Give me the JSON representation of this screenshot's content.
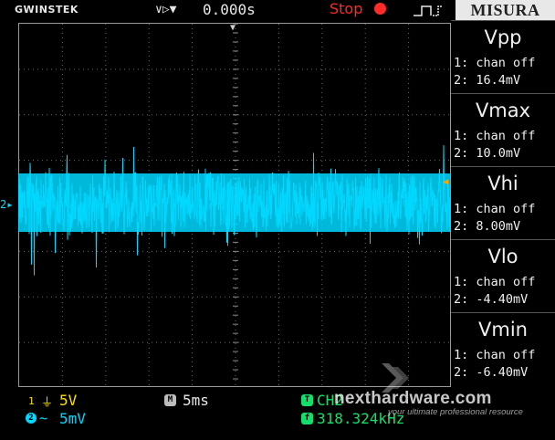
{
  "header": {
    "brand": "GWINSTEK",
    "trigger_icons": "∨▷▼",
    "time_position": "0.000s",
    "run_state": "Stop",
    "run_state_color": "#ff2a2a"
  },
  "watermark_badge": "MISURA",
  "measurements": [
    {
      "title": "Vpp",
      "ch1": "1: chan off",
      "ch2": "2: 16.4mV"
    },
    {
      "title": "Vmax",
      "ch1": "1: chan off",
      "ch2": "2: 10.0mV"
    },
    {
      "title": "Vhi",
      "ch1": "1: chan off",
      "ch2": "2: 8.00mV"
    },
    {
      "title": "Vlo",
      "ch1": "1: chan off",
      "ch2": "2: -4.40mV"
    },
    {
      "title": "Vmin",
      "ch1": "1: chan off",
      "ch2": "2: -6.40mV"
    }
  ],
  "status": {
    "ch1_number": "1",
    "ch1_coupling_icon": "⏚",
    "ch1_scale": "5V",
    "ch2_number": "2",
    "ch2_coupling_icon": "~",
    "ch2_scale": "5mV",
    "timebase_icon": "M",
    "timebase": "5ms",
    "trigger_icon": "T",
    "trigger_source": "CH2",
    "freq_icon": "f",
    "frequency": "318.324kHz"
  },
  "ch2_marker": "2▸",
  "watermark": {
    "name": "nexthardware.com",
    "tagline": "your ultimate professional resource"
  },
  "colors": {
    "ch1": "#ffe100",
    "ch2": "#00d8ff",
    "grid": "#6b6b6b",
    "trigger": "#13e06a"
  }
}
